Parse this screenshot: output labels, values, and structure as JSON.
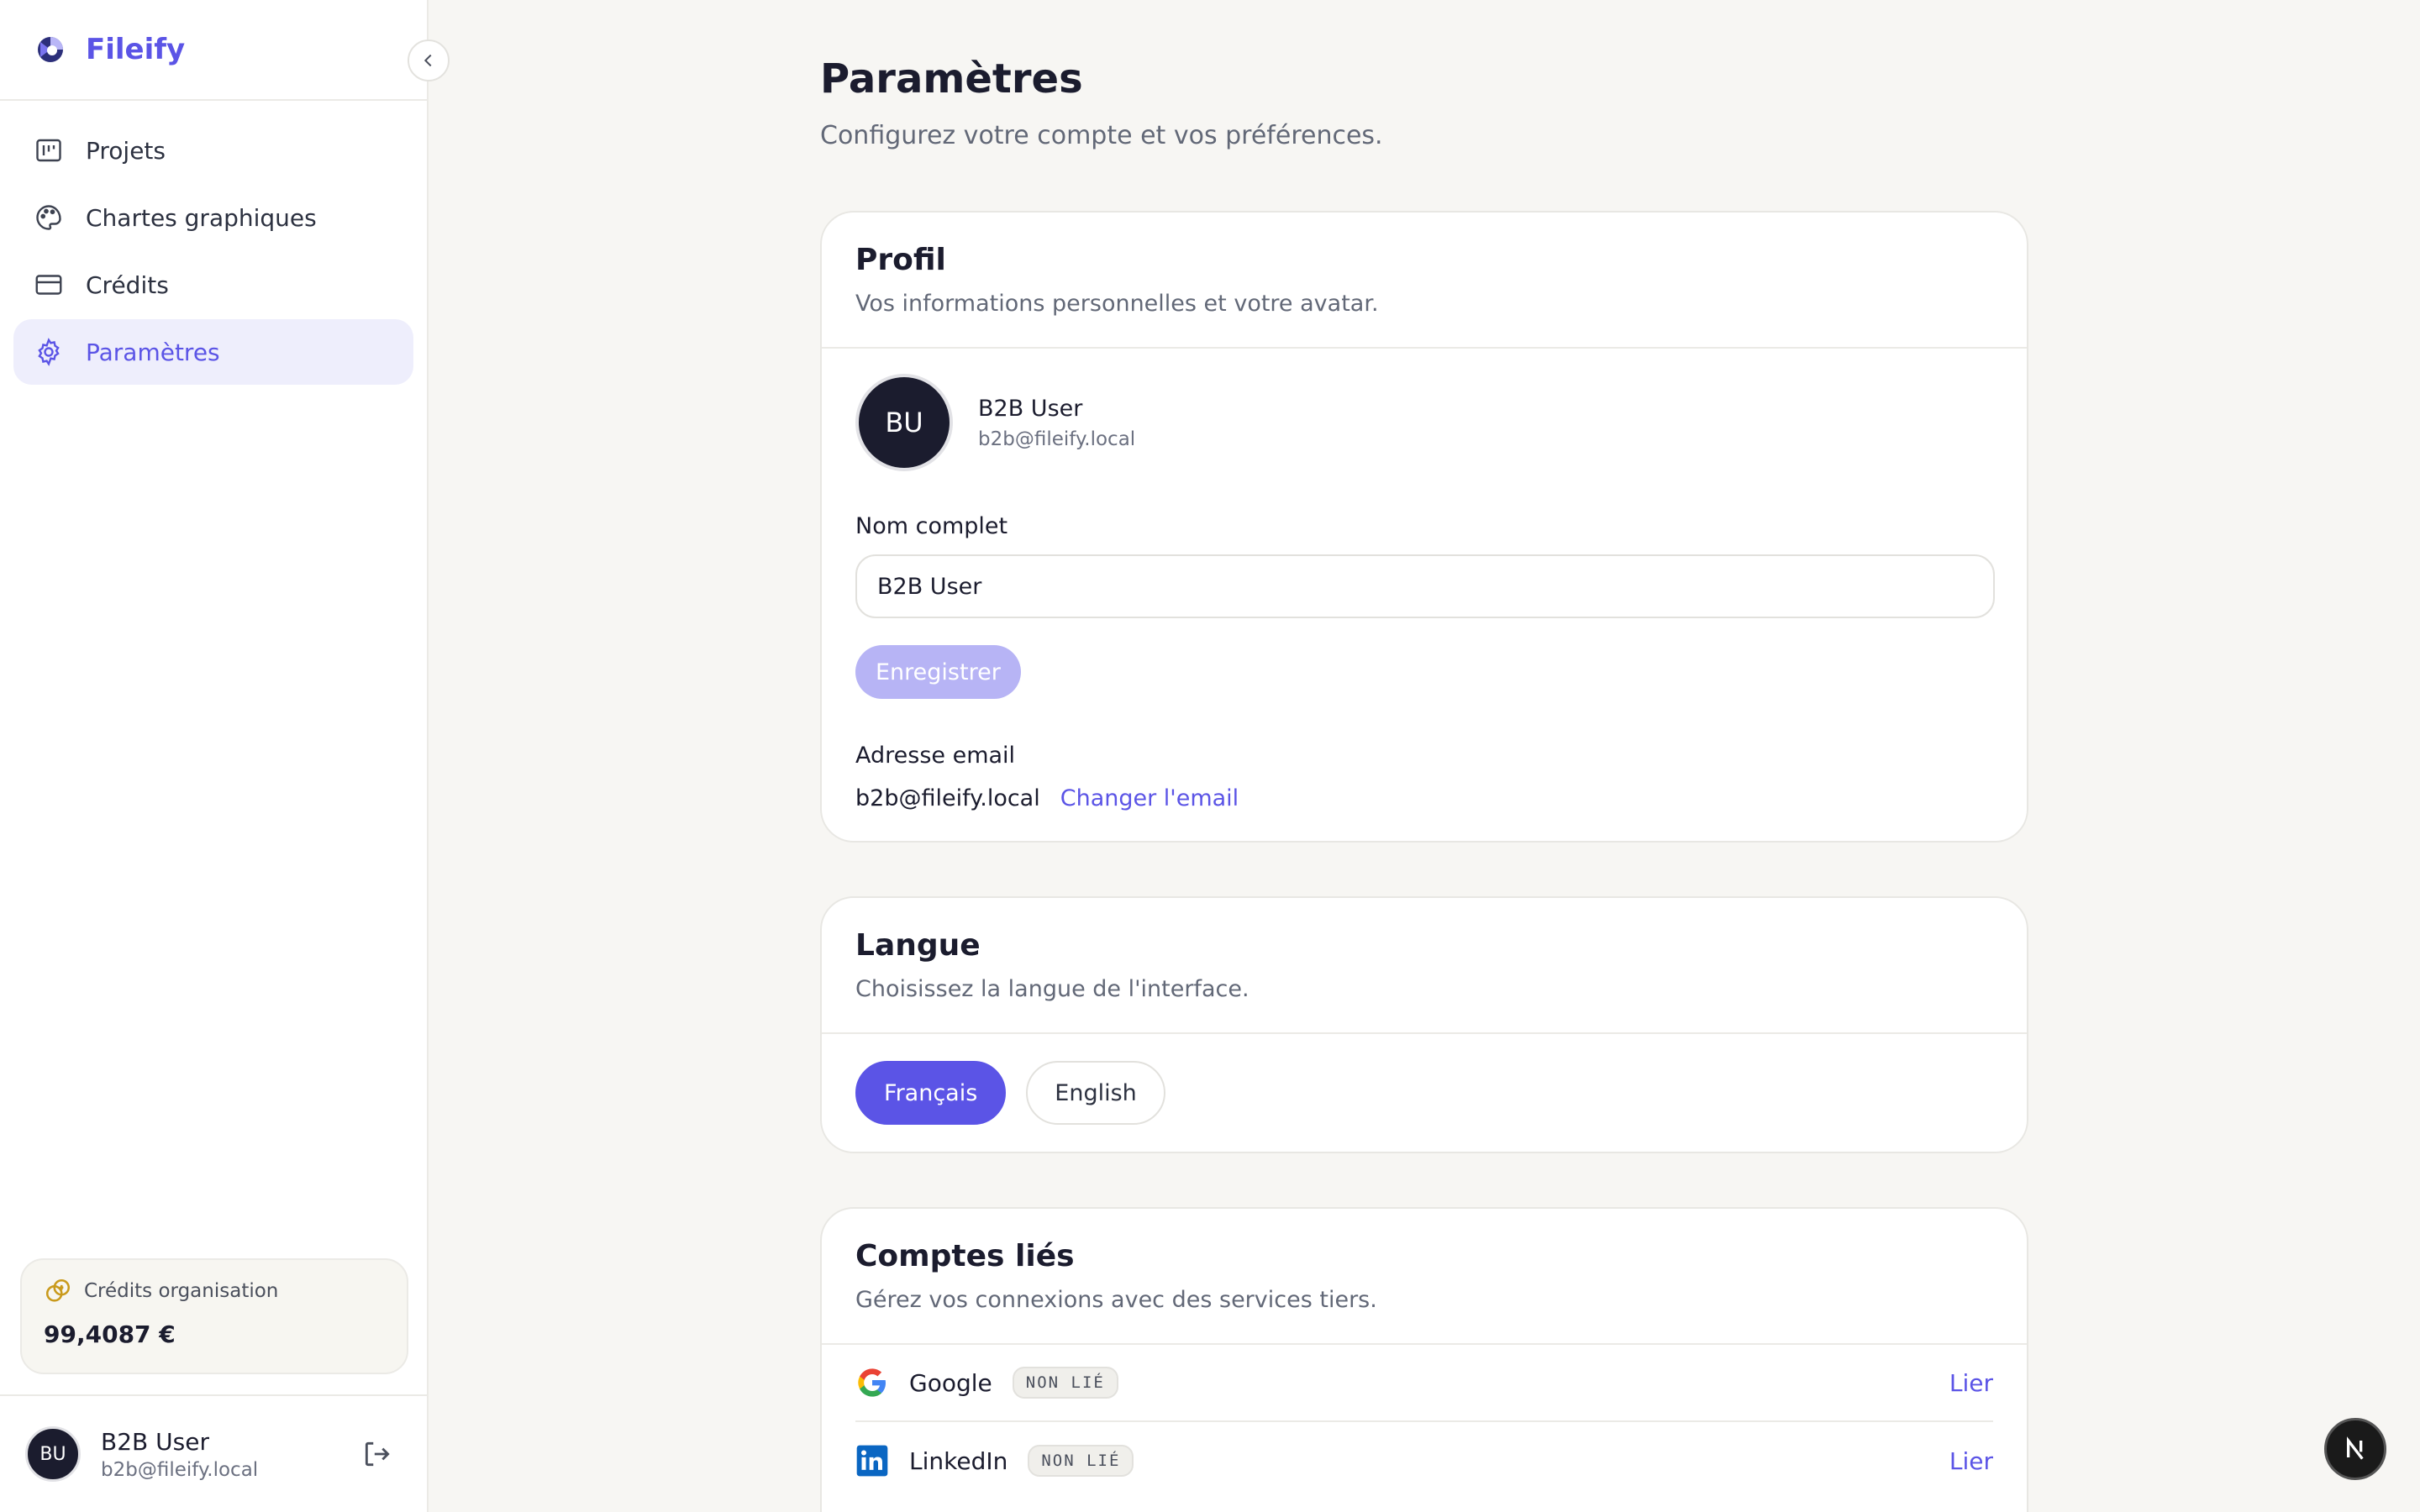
{
  "app": {
    "name": "Fileify"
  },
  "sidebar": {
    "items": [
      {
        "label": "Projets",
        "icon": "chart-icon"
      },
      {
        "label": "Chartes graphiques",
        "icon": "palette-icon"
      },
      {
        "label": "Crédits",
        "icon": "credit-card-icon"
      },
      {
        "label": "Paramètres",
        "icon": "gear-icon",
        "active": true
      }
    ],
    "credits": {
      "label": "Crédits organisation",
      "value": "99,4087 €"
    },
    "user": {
      "initials": "BU",
      "name": "B2B User",
      "email": "b2b@fileify.local"
    }
  },
  "page": {
    "title": "Paramètres",
    "subtitle": "Configurez votre compte et vos préférences."
  },
  "profile": {
    "title": "Profil",
    "description": "Vos informations personnelles et votre avatar.",
    "initials": "BU",
    "name": "B2B User",
    "email": "b2b@fileify.local",
    "full_name_label": "Nom complet",
    "full_name_value": "B2B User",
    "save_label": "Enregistrer",
    "email_label": "Adresse email",
    "email_value": "b2b@fileify.local",
    "change_email_label": "Changer l'email"
  },
  "language": {
    "title": "Langue",
    "description": "Choisissez la langue de l'interface.",
    "options": [
      {
        "label": "Français",
        "selected": true
      },
      {
        "label": "English",
        "selected": false
      }
    ]
  },
  "linked_accounts": {
    "title": "Comptes liés",
    "description": "Gérez vos connexions avec des services tiers.",
    "accounts": [
      {
        "name": "Google",
        "status": "NON LIÉ",
        "action": "Lier",
        "icon": "google-icon"
      },
      {
        "name": "LinkedIn",
        "status": "NON LIÉ",
        "action": "Lier",
        "icon": "linkedin-icon"
      }
    ]
  },
  "colors": {
    "accent": "#5b54e6",
    "accent_disabled": "#b7b4f5",
    "dark": "#1b1c2e"
  }
}
